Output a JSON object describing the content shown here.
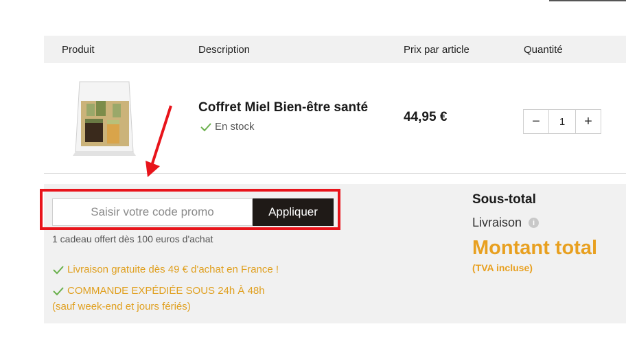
{
  "table_header": {
    "product": "Produit",
    "description": "Description",
    "unit_price": "Prix par article",
    "quantity": "Quantité"
  },
  "cart_item": {
    "name": "Coffret Miel Bien-être santé",
    "stock": "En stock",
    "price": "44,95 €",
    "quantity": "1",
    "minus_symbol": "−",
    "plus_symbol": "+",
    "image_icon": "honey-gift-box-image"
  },
  "promo": {
    "placeholder": "Saisir votre code promo",
    "apply_label": "Appliquer",
    "gift_note": "1 cadeau offert dès 100 euros d'achat",
    "highlight_color": "#e8141b"
  },
  "shipping_notes": {
    "free_shipping": "Livraison gratuite dès 49 € d'achat en France !",
    "dispatch": "COMMANDE EXPÉDIÉE SOUS 24h À 48h",
    "dispatch_note": "(sauf week-end et jours fériés)",
    "color": "#e0a020"
  },
  "summary": {
    "subtotal_label": "Sous-total",
    "shipping_label": "Livraison",
    "info_symbol": "i",
    "total_label": "Montant total",
    "tax_note": "(TVA incluse)",
    "accent": "#e8a020"
  }
}
